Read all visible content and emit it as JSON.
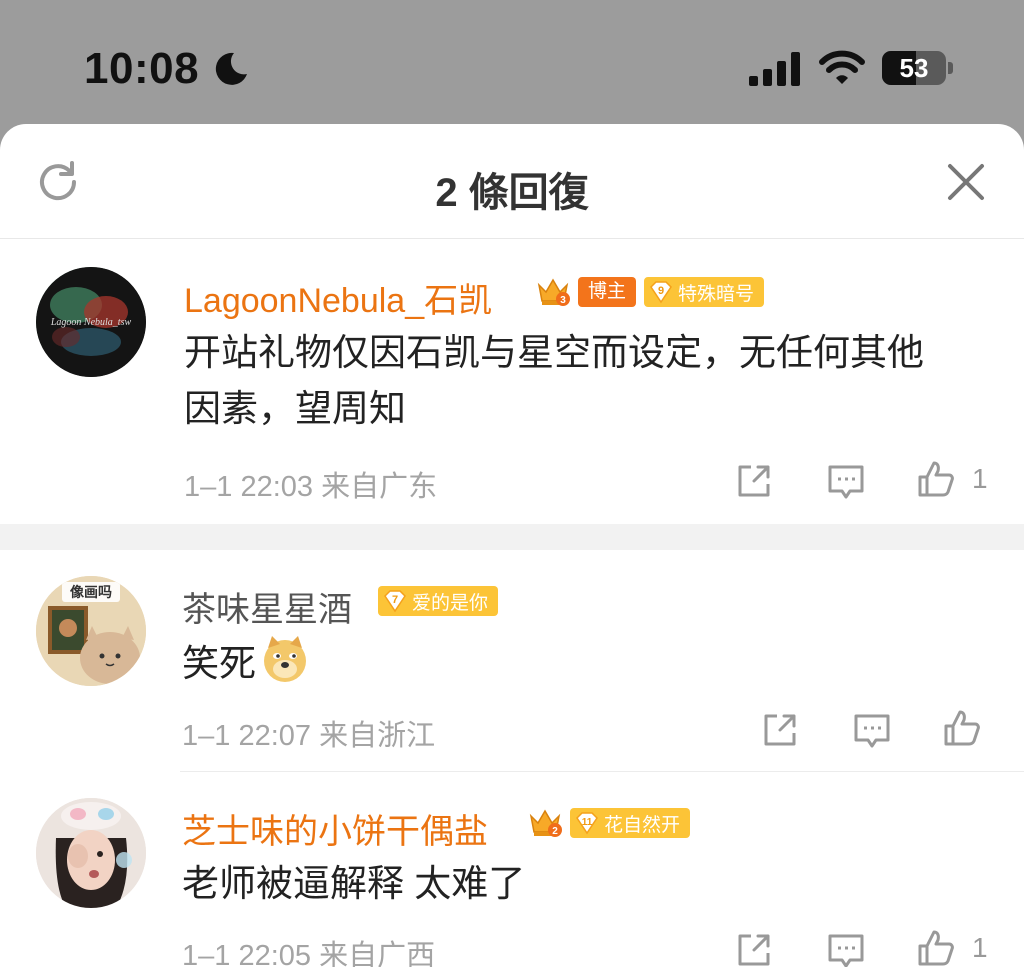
{
  "status": {
    "time": "10:08",
    "battery": "53",
    "battery_level": 0.53
  },
  "sheet": {
    "title": "2 條回復"
  },
  "main_comment": {
    "username": "LagoonNebula_石凯",
    "avatar_text": "Lagoon Nebula_tsw",
    "crown_level": "3",
    "role_badge": "博主",
    "fan_level": "9",
    "fan_badge": "特殊暗号",
    "text": "开站礼物仅因石凯与星空而设定，无任何其他因素，望周知",
    "meta": "1–1 22:03  来自广东",
    "like_count": "1"
  },
  "replies": [
    {
      "username": "茶味星星酒",
      "name_color": "gray",
      "avatar_label": "像画吗",
      "fan_level": "7",
      "fan_badge": "爱的是你",
      "text": "笑死",
      "emoji": "doge-emoji",
      "meta": "1–1 22:07  来自浙江",
      "like_count": ""
    },
    {
      "username": "芝士味的小饼干偶盐",
      "name_color": "orange",
      "crown_level": "2",
      "fan_level": "11",
      "fan_badge": "花自然开",
      "text": "老师被逼解释 太难了",
      "meta": "1–1 22:05  来自广西",
      "like_count": "1"
    }
  ],
  "colors": {
    "accent_orange": "#eb7412",
    "role_badge_bg": "#f3741b",
    "fan_badge_bg": "#fcc437",
    "meta_gray": "#a4a4a4"
  },
  "icons": [
    "moon-icon",
    "signal-icon",
    "wifi-icon",
    "battery-icon",
    "refresh-icon",
    "close-icon",
    "share-icon",
    "comment-icon",
    "like-icon",
    "crown-icon"
  ]
}
